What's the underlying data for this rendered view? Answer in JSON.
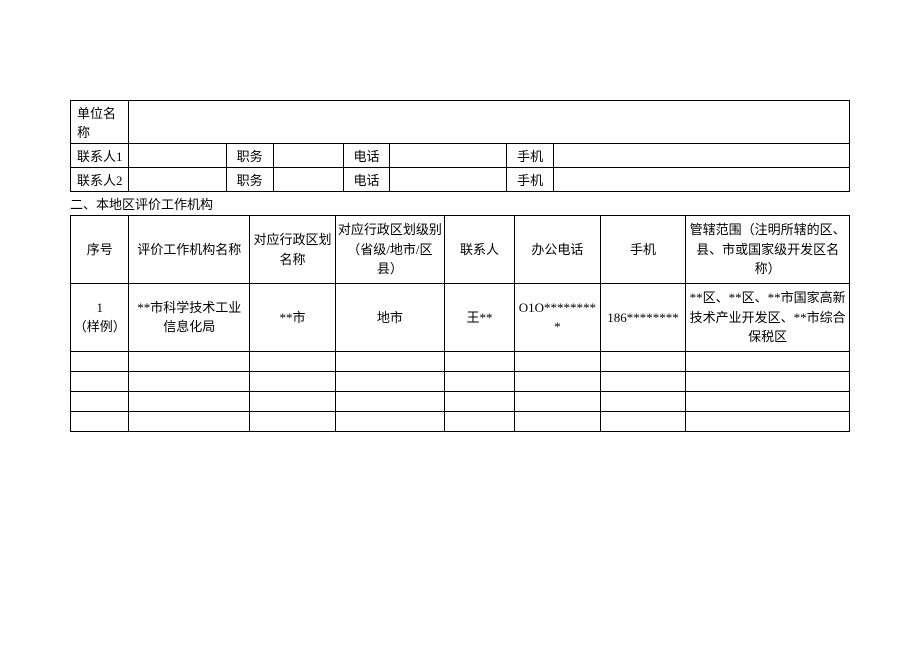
{
  "header": {
    "unit_label": "单位名称",
    "contact1_label": "联系人1",
    "contact2_label": "联系人2",
    "position_label": "职务",
    "phone_label": "电话",
    "mobile_label": "手机"
  },
  "section_title": "二、本地区评价工作机构",
  "table": {
    "headers": {
      "seq": "序号",
      "org_name": "评价工作机构名称",
      "region_name": "对应行政区划名称",
      "region_level": "对应行政区划级别（省级/地市/区县）",
      "contact": "联系人",
      "office_phone": "办公电话",
      "mobile": "手机",
      "scope": "管辖范围（注明所辖的区、县、市或国家级开发区名称）"
    },
    "sample": {
      "seq": "1\n（样例）",
      "org_name": "**市科学技术工业信息化局",
      "region_name": "**市",
      "region_level": "地市",
      "contact": "王**",
      "office_phone": "O1O*********",
      "mobile": "186********",
      "scope": "**区、**区、**市国家高新技术产业开发区、**市综合保税区"
    }
  }
}
